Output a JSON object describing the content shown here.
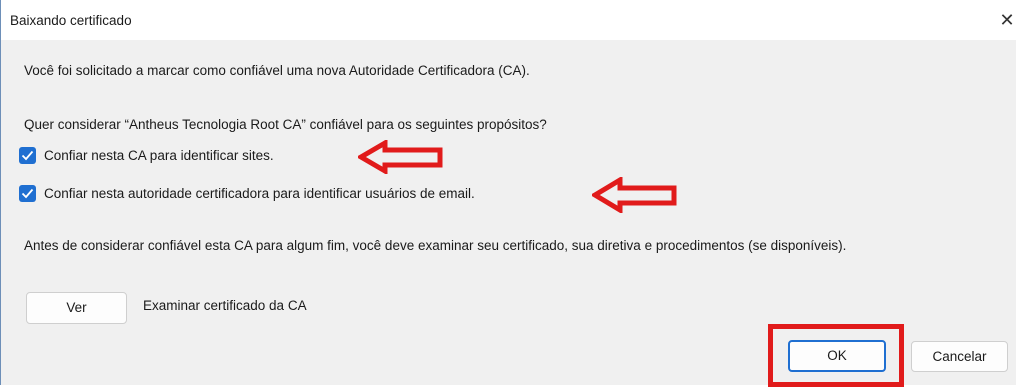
{
  "window": {
    "title": "Baixando certificado",
    "close_glyph": "✕"
  },
  "body": {
    "intro": "Você foi solicitado a marcar como confiável uma nova Autoridade Certificadora (CA).",
    "question": "Quer considerar “Antheus Tecnologia Root CA” confiável para os seguintes propósitos?",
    "checkboxes": [
      {
        "label": "Confiar nesta CA para identificar sites.",
        "checked": true
      },
      {
        "label": "Confiar nesta autoridade certificadora para identificar usuários de email.",
        "checked": true
      }
    ],
    "notice": "Antes de considerar confiável esta CA para algum fim, você deve examinar seu certificado, sua diretiva e procedimentos (se disponíveis).",
    "view_button": "Ver",
    "view_description": "Examinar certificado da CA"
  },
  "footer": {
    "ok_button": "OK",
    "cancel_button": "Cancelar"
  },
  "colors": {
    "accent": "#1f6fd1",
    "annotation": "#e11b1b"
  },
  "annotations": [
    "arrow-icon",
    "highlight-box"
  ]
}
